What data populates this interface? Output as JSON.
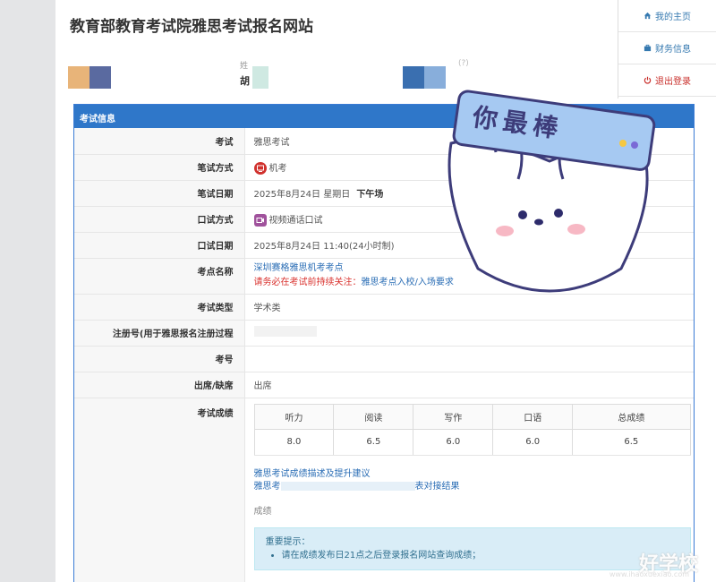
{
  "site": {
    "title": "教育部教育考试院雅思考试报名网站"
  },
  "nav": {
    "home": "我的主页",
    "finance": "财务信息",
    "logout": "退出登录"
  },
  "profile": {
    "name_label": "姓",
    "name_value": "胡",
    "note": "(?)"
  },
  "panel": {
    "header": "考试信息",
    "rows": {
      "exam": {
        "label": "考试",
        "value": "雅思考试"
      },
      "written_mode": {
        "label": "笔试方式",
        "value": "机考"
      },
      "written_date": {
        "label": "笔试日期",
        "value": "2025年8月24日 星期日",
        "extra": "下午场"
      },
      "oral_mode": {
        "label": "口试方式",
        "value": "视频通话口试"
      },
      "oral_date": {
        "label": "口试日期",
        "value": "2025年8月24日 11:40(24小时制)"
      },
      "center": {
        "label": "考点名称",
        "value": "深圳赛格雅思机考考点",
        "notice_prefix": "请务必在考试前持续关注：",
        "notice_link": "雅思考点入校/入场要求"
      },
      "exam_type": {
        "label": "考试类型",
        "value": "学术类"
      },
      "reg_no": {
        "label": "注册号(用于雅思报名注册过程",
        "value": ""
      },
      "exam_no": {
        "label": "考号",
        "value": ""
      },
      "attendance": {
        "label": "出席/缺席",
        "value": "出席"
      },
      "scores": {
        "label": "考试成绩"
      }
    }
  },
  "scores": {
    "headers": [
      "听力",
      "阅读",
      "写作",
      "口语",
      "总成绩"
    ],
    "values": [
      "8.0",
      "6.5",
      "6.0",
      "6.0",
      "6.5"
    ]
  },
  "links": {
    "advice": "雅思考试成绩描述及提升建议",
    "cefr": "雅思考",
    "cefr_tail": "表对接结果",
    "score_label": "成绩"
  },
  "tips": {
    "title": "重要提示：",
    "items": [
      "请在成绩发布日21点之后登录报名网站查询成绩；"
    ]
  },
  "sticker": {
    "text": "你最棒"
  },
  "watermark": {
    "text": "好学校",
    "sub": "www.ihaoxuexiao.com"
  },
  "colors": {
    "primary": "#2f77c9",
    "link": "#2a6db5",
    "danger": "#d9302c",
    "tip_bg": "#d9edf7"
  }
}
